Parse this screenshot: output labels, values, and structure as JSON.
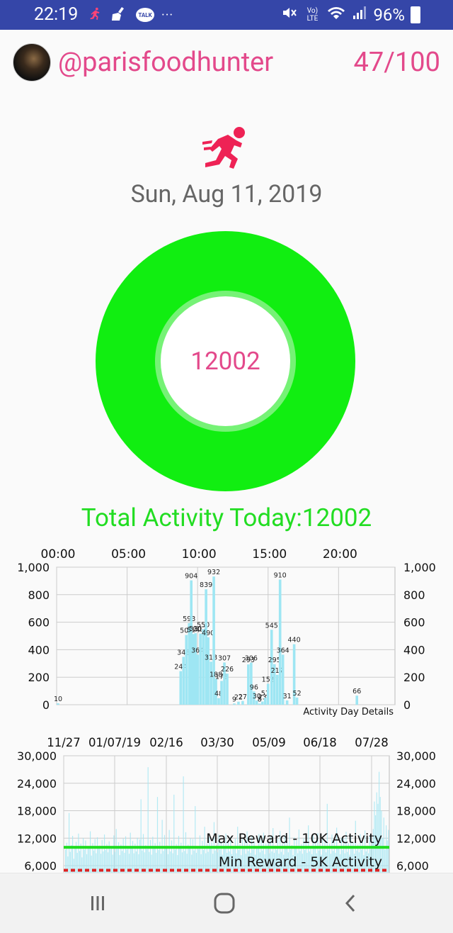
{
  "status_bar": {
    "time": "22:19",
    "battery": "96%",
    "icons_left": [
      "runner-icon",
      "broom-icon",
      "talk-icon",
      "more-icon"
    ],
    "icons_right": [
      "mute-icon",
      "volte-icon",
      "wifi-icon",
      "signal-icon",
      "battery-icon"
    ],
    "talk_label": "TALK",
    "volte_label": "Vo) LTE",
    "more_label": "···"
  },
  "header": {
    "username": "@parisfoodhunter",
    "score": "47/100"
  },
  "main": {
    "date": "Sun, Aug 11, 2019",
    "ring_value": "12002",
    "total_label": "Total Activity Today:12002"
  },
  "colors": {
    "accent_pink": "#e3498b",
    "ring_green": "#11ee11",
    "bar_cyan": "#a6e6f2",
    "reward_green": "#22dd22",
    "min_red": "#dd2222"
  },
  "chart_data": [
    {
      "type": "bar",
      "title": "",
      "annotation": "Activity Day Details",
      "x_ticks": [
        "00:00",
        "05:00",
        "10:00",
        "15:00",
        "20:00"
      ],
      "ylim": [
        0,
        1000
      ],
      "y_ticks": [
        "0",
        "200",
        "400",
        "600",
        "800",
        "1,000"
      ],
      "bars": [
        {
          "t": 0.1,
          "v": 10,
          "label": "10"
        },
        {
          "t": 8.8,
          "v": 244,
          "label": "244"
        },
        {
          "t": 9.0,
          "v": 348,
          "label": "348"
        },
        {
          "t": 9.2,
          "v": 507,
          "label": "507"
        },
        {
          "t": 9.4,
          "v": 593,
          "label": "593"
        },
        {
          "t": 9.55,
          "v": 904,
          "label": "904"
        },
        {
          "t": 9.7,
          "v": 514,
          "label": "514"
        },
        {
          "t": 9.85,
          "v": 520,
          "label": "520"
        },
        {
          "t": 10.0,
          "v": 364,
          "label": "364"
        },
        {
          "t": 10.2,
          "v": 517,
          "label": "517"
        },
        {
          "t": 10.4,
          "v": 550,
          "label": "550"
        },
        {
          "t": 10.6,
          "v": 839,
          "label": "839"
        },
        {
          "t": 10.75,
          "v": 490,
          "label": "490"
        },
        {
          "t": 10.95,
          "v": 313,
          "label": "313"
        },
        {
          "t": 11.15,
          "v": 932,
          "label": "932"
        },
        {
          "t": 11.3,
          "v": 188,
          "label": "188"
        },
        {
          "t": 11.5,
          "v": 48,
          "label": "48"
        },
        {
          "t": 11.7,
          "v": 173,
          "label": "173"
        },
        {
          "t": 11.9,
          "v": 307,
          "label": "307"
        },
        {
          "t": 12.1,
          "v": 226,
          "label": "226"
        },
        {
          "t": 12.6,
          "v": 9,
          "label": "9"
        },
        {
          "t": 12.9,
          "v": 22,
          "label": "22"
        },
        {
          "t": 13.2,
          "v": 27,
          "label": "27"
        },
        {
          "t": 13.6,
          "v": 293,
          "label": "293"
        },
        {
          "t": 13.8,
          "v": 306,
          "label": "306"
        },
        {
          "t": 14.0,
          "v": 96,
          "label": "96"
        },
        {
          "t": 14.2,
          "v": 30,
          "label": "30"
        },
        {
          "t": 14.4,
          "v": 8,
          "label": "8"
        },
        {
          "t": 14.6,
          "v": 23,
          "label": "23"
        },
        {
          "t": 14.8,
          "v": 51,
          "label": "51"
        },
        {
          "t": 15.0,
          "v": 152,
          "label": "152"
        },
        {
          "t": 15.25,
          "v": 545,
          "label": "545"
        },
        {
          "t": 15.45,
          "v": 295,
          "label": "295"
        },
        {
          "t": 15.65,
          "v": 217,
          "label": "217"
        },
        {
          "t": 15.85,
          "v": 910,
          "label": "910"
        },
        {
          "t": 16.05,
          "v": 364,
          "label": "364"
        },
        {
          "t": 16.35,
          "v": 31,
          "label": "31"
        },
        {
          "t": 16.85,
          "v": 440,
          "label": "440"
        },
        {
          "t": 17.05,
          "v": 52,
          "label": "52"
        },
        {
          "t": 21.3,
          "v": 66,
          "label": "66"
        }
      ]
    },
    {
      "type": "bar",
      "title": "",
      "x_ticks": [
        "11/27",
        "01/07/19",
        "02/16",
        "03/30",
        "05/09",
        "06/18",
        "07/28"
      ],
      "ylim": [
        6000,
        30000
      ],
      "y_ticks": [
        "6,000",
        "12,000",
        "18,000",
        "24,000",
        "30,000"
      ],
      "max_reward": {
        "label": "Max Reward - 10K Activity",
        "value": 10000
      },
      "min_reward": {
        "label": "Min Reward - 5K Activity",
        "value": 5000
      },
      "daily_values": [
        9500,
        11000,
        8000,
        17500,
        9000,
        10500,
        12500,
        7500,
        9800,
        11200,
        8800,
        13000,
        9200,
        10800,
        7800,
        12000,
        9500,
        11500,
        8500,
        10200,
        9700,
        13500,
        8200,
        10900,
        9300,
        11800,
        8700,
        12200,
        9900,
        10400,
        8600,
        11600,
        9100,
        12800,
        9400,
        10700,
        8900,
        11300,
        9600,
        10100,
        8400,
        12600,
        9000,
        14000,
        9700,
        11100,
        8300,
        10600,
        9200,
        11900,
        8800,
        12400,
        9500,
        10300,
        8600,
        13200,
        9800,
        11400,
        8700,
        10800,
        9100,
        12100,
        8500,
        11700,
        20500,
        9300,
        12900,
        8900,
        10500,
        9600,
        27500,
        9000,
        11600,
        8400,
        12300,
        9700,
        10900,
        8800,
        21000,
        9400,
        11200,
        8600,
        16000,
        9200,
        12700,
        9800,
        10400,
        8500,
        13800,
        9100,
        11500,
        8700,
        21500,
        9500,
        10700,
        8300,
        12500,
        9900,
        11000,
        8900,
        25500,
        9200,
        13300,
        8600,
        10600,
        9700,
        12000,
        8400,
        11800,
        9300,
        19000,
        8800,
        10200,
        9600,
        12600,
        8500,
        11400,
        9400,
        14500,
        8700,
        10800,
        9000,
        12200,
        9800,
        11100,
        8600,
        15500,
        9300,
        10500,
        8900,
        12800,
        9500,
        11300,
        8400,
        10900,
        9700,
        13000,
        8800,
        11600,
        9100,
        12300,
        8500,
        10300,
        9600,
        11900,
        8700,
        14500,
        9400,
        10700,
        8300,
        12100,
        9900,
        11500,
        8600,
        13500,
        9200,
        10600,
        8800,
        12400,
        9500,
        11200,
        8400,
        10100,
        9700,
        12900,
        8900,
        11700,
        9300,
        13200,
        8500,
        10800,
        9600,
        11000,
        8700,
        12500,
        9100,
        14200,
        8800,
        10400,
        9400,
        11800,
        8600,
        13600,
        9000,
        10900,
        8400,
        12700,
        9800,
        11300,
        8900,
        16500,
        9500,
        10500,
        8300,
        12200,
        9700,
        11600,
        8700,
        13900,
        9200,
        10700,
        8600,
        12000,
        9400,
        11100,
        8800,
        14800,
        9100,
        10300,
        8500,
        12600,
        9900,
        11400,
        8700,
        13100,
        9300,
        10600,
        8400,
        12300,
        9600,
        11700,
        8900,
        19500,
        9500,
        10800,
        8600,
        12800,
        9200,
        11500,
        8800,
        14300,
        9700,
        10200,
        8500,
        12100,
        9400,
        11900,
        8700,
        13400,
        9000,
        10900,
        8400,
        12400,
        9800,
        11200,
        8600,
        15800,
        9300,
        10600,
        8900,
        12900,
        9500,
        11800,
        8300,
        13700,
        9100,
        10400,
        8700,
        12500,
        9600,
        11300,
        14000,
        20000,
        17000,
        22000,
        19500,
        26500,
        21000,
        18000,
        12000,
        16500,
        9500,
        14800,
        11500,
        13800
      ]
    }
  ],
  "nav": {
    "recent": "recent-apps-icon",
    "home": "home-icon",
    "back": "back-icon"
  }
}
